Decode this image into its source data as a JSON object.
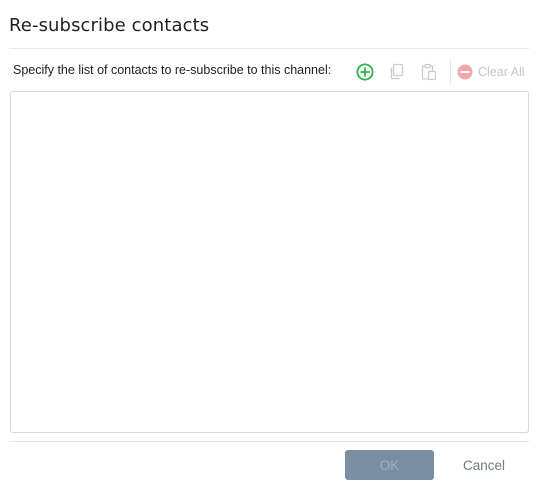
{
  "dialog": {
    "title": "Re-subscribe contacts",
    "instruction": "Specify the list of contacts to re-subscribe to this channel:"
  },
  "toolbar": {
    "add_icon": "add-circle-icon",
    "copy_icon": "copy-icon",
    "paste_icon": "paste-icon",
    "clear_icon": "minus-circle-icon",
    "clear_all_label": "Clear All",
    "colors": {
      "add": "#2bb24c",
      "disabled": "#c8ccd2",
      "clear": "#f2a8ab"
    }
  },
  "contacts": {
    "items": []
  },
  "footer": {
    "ok_label": "OK",
    "cancel_label": "Cancel",
    "ok_color": "#7a8fa2"
  }
}
